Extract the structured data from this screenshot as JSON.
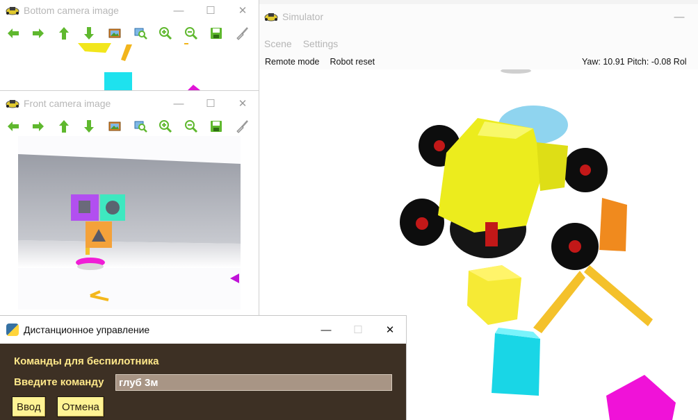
{
  "bottom_camera": {
    "title": "Bottom camera image"
  },
  "front_camera": {
    "title": "Front camera image"
  },
  "simulator": {
    "title": "Simulator",
    "menu": [
      "Scene",
      "Settings"
    ],
    "controls": {
      "remote_mode": "Remote mode",
      "robot_reset": "Robot reset"
    },
    "readout": "Yaw: 10.91 Pitch: -0.08 Rol"
  },
  "remote": {
    "title": "Дистанционное управление",
    "heading": "Команды для беспилотника",
    "prompt": "Введите команду",
    "input_value": "глуб 3м",
    "enter_label": "Ввод",
    "cancel_label": "Отмена"
  },
  "window_controls": {
    "minimize": "—",
    "maximize": "☐",
    "close": "✕"
  },
  "colors": {
    "dialog_bg": "#3d3024",
    "dialog_text": "#ffe88a",
    "button_bg": "#fff394",
    "input_bg": "#a89585",
    "toolbar_green": "#5fb82e"
  },
  "toolbar_icons": [
    "arrow-left-icon",
    "arrow-right-icon",
    "arrow-up-icon",
    "arrow-down-icon",
    "image-icon",
    "zoom-fit-icon",
    "zoom-in-icon",
    "zoom-out-icon",
    "save-icon",
    "brush-icon"
  ]
}
